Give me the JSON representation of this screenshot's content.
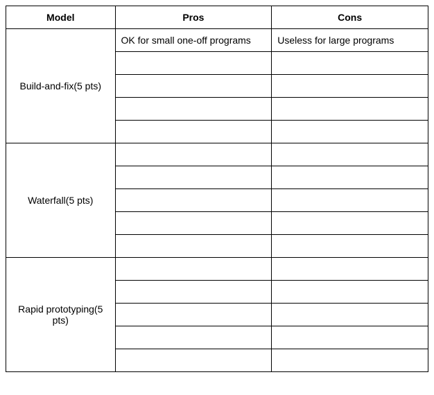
{
  "headers": {
    "model": "Model",
    "pros": "Pros",
    "cons": "Cons"
  },
  "rows": [
    {
      "model": "Build-and-fix(5 pts)",
      "pros": [
        "OK for small one-off programs",
        "",
        "",
        "",
        ""
      ],
      "cons": [
        "Useless for large programs",
        "",
        "",
        "",
        ""
      ]
    },
    {
      "model": "Waterfall(5 pts)",
      "pros": [
        "",
        "",
        "",
        "",
        ""
      ],
      "cons": [
        "",
        "",
        "",
        "",
        ""
      ]
    },
    {
      "model": "Rapid prototyping(5 pts)",
      "pros": [
        "",
        "",
        "",
        "",
        ""
      ],
      "cons": [
        "",
        "",
        "",
        "",
        ""
      ]
    }
  ]
}
